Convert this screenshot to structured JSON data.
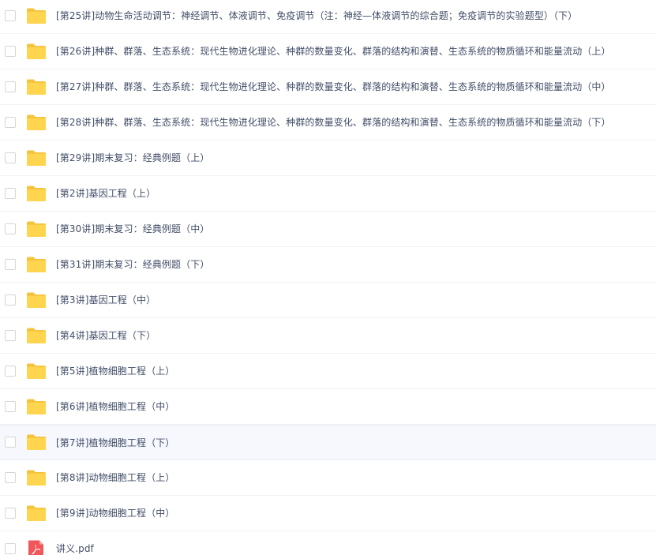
{
  "file_list": {
    "items": [
      {
        "name": "[第25讲]动物生命活动调节：神经调节、体液调节、免疫调节（注：神经—体液调节的综合题；免疫调节的实验题型）（下）",
        "type": "folder",
        "icon": "folder-icon"
      },
      {
        "name": "[第26讲]种群、群落、生态系统：现代生物进化理论、种群的数量变化、群落的结构和演替、生态系统的物质循环和能量流动（上）",
        "type": "folder",
        "icon": "folder-icon"
      },
      {
        "name": "[第27讲]种群、群落、生态系统：现代生物进化理论、种群的数量变化、群落的结构和演替、生态系统的物质循环和能量流动（中）",
        "type": "folder",
        "icon": "folder-icon"
      },
      {
        "name": "[第28讲]种群、群落、生态系统：现代生物进化理论、种群的数量变化、群落的结构和演替、生态系统的物质循环和能量流动（下）",
        "type": "folder",
        "icon": "folder-icon"
      },
      {
        "name": "[第29讲]期末复习：经典例题（上）",
        "type": "folder",
        "icon": "folder-icon"
      },
      {
        "name": "[第2讲]基因工程（上）",
        "type": "folder",
        "icon": "folder-icon"
      },
      {
        "name": "[第30讲]期末复习：经典例题（中）",
        "type": "folder",
        "icon": "folder-icon"
      },
      {
        "name": "[第31讲]期末复习：经典例题（下）",
        "type": "folder",
        "icon": "folder-icon"
      },
      {
        "name": "[第3讲]基因工程（中）",
        "type": "folder",
        "icon": "folder-icon"
      },
      {
        "name": "[第4讲]基因工程（下）",
        "type": "folder",
        "icon": "folder-icon"
      },
      {
        "name": "[第5讲]植物细胞工程（上）",
        "type": "folder",
        "icon": "folder-icon"
      },
      {
        "name": "[第6讲]植物细胞工程（中）",
        "type": "folder",
        "icon": "folder-icon"
      },
      {
        "name": "[第7讲]植物细胞工程（下）",
        "type": "folder",
        "icon": "folder-icon",
        "hovered": true
      },
      {
        "name": "[第8讲]动物细胞工程（上）",
        "type": "folder",
        "icon": "folder-icon"
      },
      {
        "name": "[第9讲]动物细胞工程（中）",
        "type": "folder",
        "icon": "folder-icon"
      },
      {
        "name": "讲义.pdf",
        "type": "pdf",
        "icon": "pdf-icon"
      }
    ]
  },
  "colors": {
    "folder_back": "#f5c33b",
    "folder_front": "#ffd44f",
    "pdf_red": "#f0565a",
    "text": "#424e67",
    "hover_bg": "#f6f8fd"
  }
}
